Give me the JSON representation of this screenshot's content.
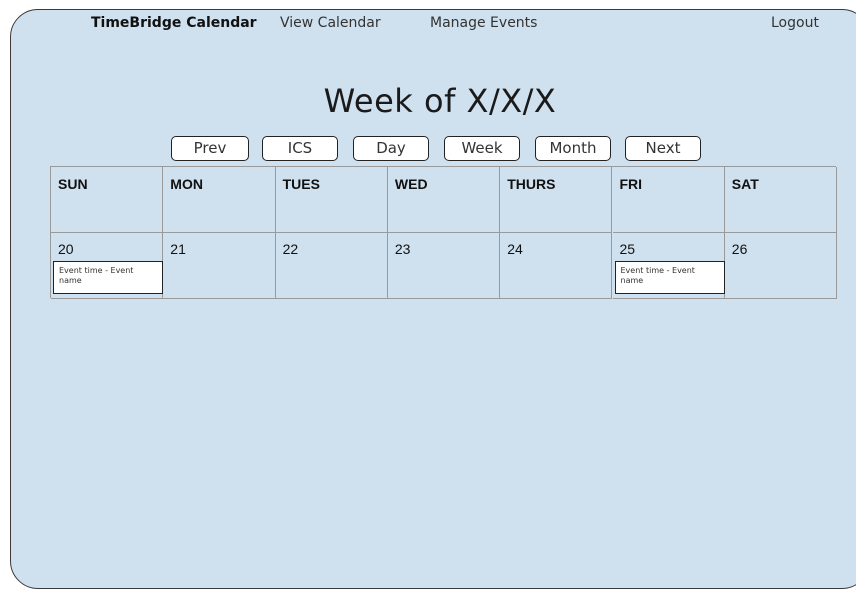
{
  "nav": {
    "brand": "TimeBridge Calendar",
    "view_calendar": "View Calendar",
    "manage_events": "Manage Events",
    "logout": "Logout"
  },
  "title": "Week of X/X/X",
  "buttons": {
    "prev": "Prev",
    "ics": "ICS",
    "day": "Day",
    "week": "Week",
    "month": "Month",
    "next": "Next"
  },
  "calendar": {
    "days": [
      "SUN",
      "MON",
      "TUES",
      "WED",
      "THURS",
      "FRI",
      "SAT"
    ],
    "dates": [
      "20",
      "21",
      "22",
      "23",
      "24",
      "25",
      "26"
    ],
    "events": {
      "sun": "Event time - Event name",
      "fri": "Event time - Event name"
    }
  },
  "colors": {
    "background": "#cfe0ef",
    "button_bg": "#ffffff",
    "border": "#9a9a9a"
  }
}
